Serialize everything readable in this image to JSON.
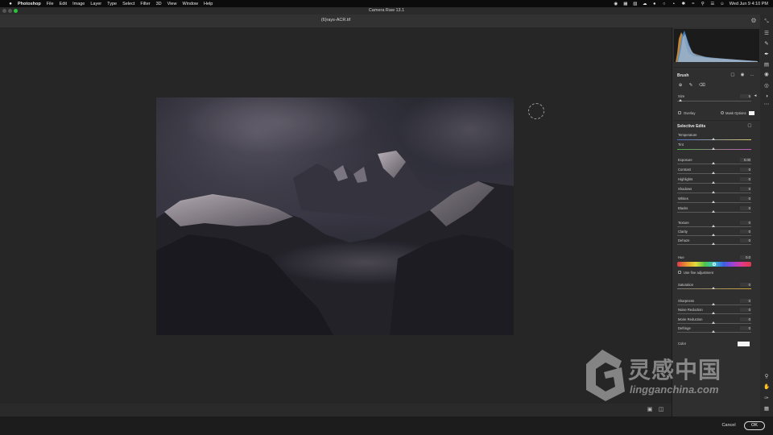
{
  "menubar": {
    "app": "Photoshop",
    "items": [
      "File",
      "Edit",
      "Image",
      "Layer",
      "Type",
      "Select",
      "Filter",
      "3D",
      "View",
      "Window",
      "Help"
    ],
    "clock": "Wed Jun 9  4:10 PM"
  },
  "window": {
    "title": "Camera Raw 13.1",
    "document": "(6)rays-ACR.tif"
  },
  "brush": {
    "title": "Brush",
    "size_label": "Size",
    "size_value": "5",
    "overlay_label": "Overlay",
    "mask_options_label": "Mask Options"
  },
  "selective_edits": {
    "title": "Selective Edits",
    "color_sliders": [
      {
        "label": "Temperature",
        "value": 0
      },
      {
        "label": "Tint",
        "value": 0
      }
    ],
    "tone_sliders": [
      {
        "label": "Exposure",
        "value": "0.00"
      },
      {
        "label": "Contrast",
        "value": "0"
      },
      {
        "label": "Highlights",
        "value": "0"
      },
      {
        "label": "Shadows",
        "value": "0"
      },
      {
        "label": "Whites",
        "value": "0"
      },
      {
        "label": "Blacks",
        "value": "0"
      }
    ],
    "presence_sliders": [
      {
        "label": "Texture",
        "value": "0"
      },
      {
        "label": "Clarity",
        "value": "0"
      },
      {
        "label": "Dehaze",
        "value": "0"
      }
    ],
    "hue_label": "Hue",
    "hue_value": "0.0",
    "fine_adjustment_label": "Use fine adjustment",
    "saturation_label": "Saturation",
    "saturation_value": "0",
    "detail_sliders": [
      {
        "label": "Sharpness",
        "value": "0"
      },
      {
        "label": "Noise Reduction",
        "value": "0"
      },
      {
        "label": "Moire Reduction",
        "value": "0"
      },
      {
        "label": "Defringe",
        "value": "0"
      }
    ],
    "color_label": "Color"
  },
  "footer": {
    "cancel_label": "Cancel",
    "ok_label": "OK"
  },
  "watermark": {
    "cn": "灵感中国",
    "en": "lingganchina.com"
  }
}
